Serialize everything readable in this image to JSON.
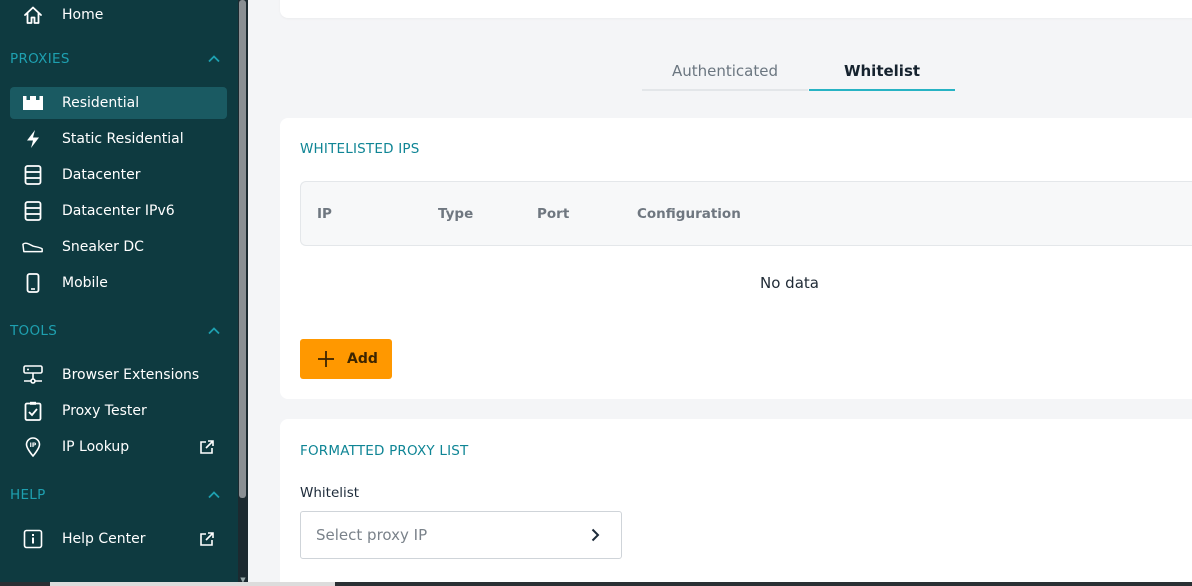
{
  "sidebar": {
    "home": "Home",
    "proxies_header": "PROXIES",
    "proxies": [
      {
        "label": "Residential",
        "icon": "crown-icon"
      },
      {
        "label": "Static Residential",
        "icon": "bolt-icon"
      },
      {
        "label": "Datacenter",
        "icon": "server-icon"
      },
      {
        "label": "Datacenter IPv6",
        "icon": "server-icon"
      },
      {
        "label": "Sneaker DC",
        "icon": "sneaker-icon"
      },
      {
        "label": "Mobile",
        "icon": "mobile-icon"
      }
    ],
    "tools_header": "TOOLS",
    "tools": [
      {
        "label": "Browser Extensions",
        "icon": "network-icon"
      },
      {
        "label": "Proxy Tester",
        "icon": "clipboard-check-icon"
      },
      {
        "label": "IP Lookup",
        "icon": "location-pin-icon"
      }
    ],
    "help_header": "HELP",
    "help": [
      {
        "label": "Help Center",
        "icon": "info-icon"
      }
    ]
  },
  "tabs": {
    "authenticated": "Authenticated",
    "whitelist": "Whitelist",
    "active": "Whitelist"
  },
  "whitelisted": {
    "title": "WHITELISTED IPS",
    "columns": [
      "IP",
      "Type",
      "Port",
      "Configuration"
    ],
    "empty_text": "No data",
    "add_label": "Add"
  },
  "formatted": {
    "title": "FORMATTED PROXY LIST",
    "field_label": "Whitelist",
    "select_placeholder": "Select proxy IP"
  },
  "colors": {
    "sidebar_bg": "#0e3a40",
    "accent": "#1ea0b0",
    "add_button": "#ff9800",
    "tab_underline": "#27b3c4"
  }
}
